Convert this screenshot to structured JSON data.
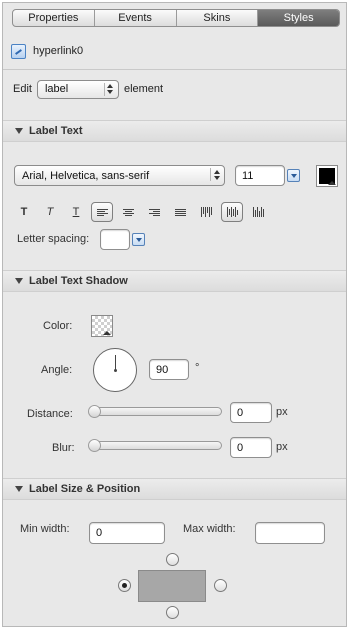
{
  "tabs": [
    {
      "label": "Properties",
      "active": false
    },
    {
      "label": "Events",
      "active": false
    },
    {
      "label": "Skins",
      "active": false
    },
    {
      "label": "Styles",
      "active": true
    }
  ],
  "object": {
    "name": "hyperlink0",
    "icon": "hyperlink-icon"
  },
  "edit": {
    "prefix": "Edit",
    "element": "label",
    "suffix": "element"
  },
  "label_text": {
    "title": "Label Text",
    "font_family": "Arial, Helvetica, sans-serif",
    "font_size": "11",
    "text_color": "#000000",
    "format_buttons": {
      "bold": "T",
      "italic": "T",
      "underline": "T"
    },
    "letter_spacing_label": "Letter spacing:",
    "letter_spacing_value": ""
  },
  "label_text_shadow": {
    "title": "Label Text Shadow",
    "color_label": "Color:",
    "angle_label": "Angle:",
    "angle_value": "90",
    "angle_unit": "°",
    "distance_label": "Distance:",
    "distance_value": "0",
    "distance_unit": "px",
    "blur_label": "Blur:",
    "blur_value": "0",
    "blur_unit": "px"
  },
  "label_size_position": {
    "title": "Label Size & Position",
    "min_width_label": "Min width:",
    "min_width_value": "0",
    "max_width_label": "Max width:",
    "max_width_value": "",
    "position_selected": "left"
  },
  "colors": {
    "active_tab": "#6b6b6b",
    "panel_bg": "#e8e8e8",
    "position_box": "#a7a7a7",
    "accent_blue": "#4a82c4"
  }
}
